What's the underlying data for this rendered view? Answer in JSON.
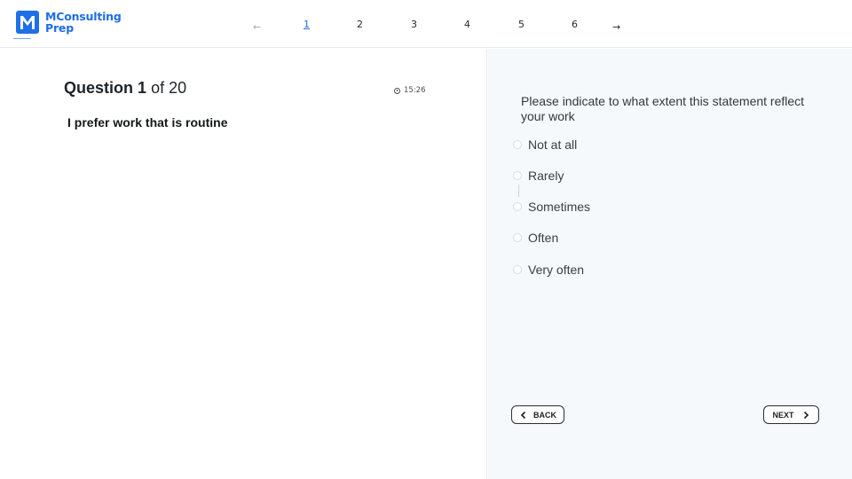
{
  "brand": {
    "line1": "MConsulting",
    "line2": "Prep",
    "color": "#1f6fe5"
  },
  "pagination": {
    "prev_icon": "arrow-left-icon",
    "next_icon": "arrow-right-icon",
    "pages": [
      "1",
      "2",
      "3",
      "4",
      "5",
      "6"
    ],
    "current": "1"
  },
  "question": {
    "label": "Question",
    "number": "1",
    "of_text": "of 20",
    "timer": "15:26",
    "statement": "I prefer work that is routine"
  },
  "answer_panel": {
    "prompt": "Please indicate to what extent this statement reflect your work",
    "options": [
      "Not at all",
      "Rarely",
      "Sometimes",
      "Often",
      "Very often"
    ]
  },
  "navigation": {
    "back_label": "BACK",
    "next_label": "NEXT"
  }
}
